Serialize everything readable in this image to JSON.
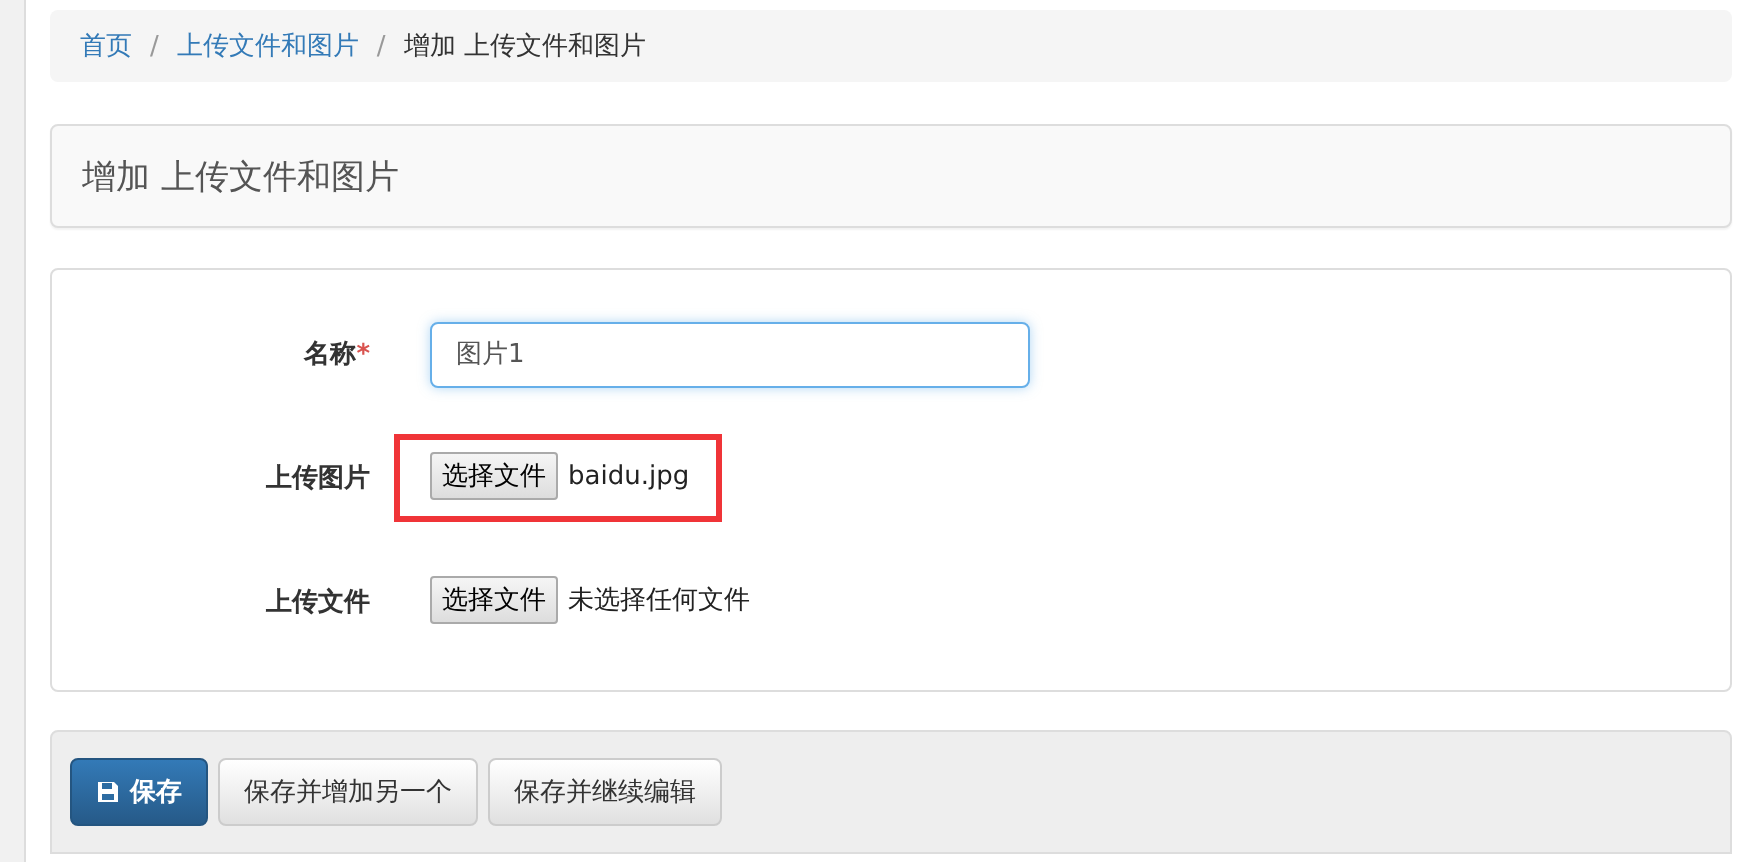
{
  "breadcrumb": [
    {
      "label": "首页",
      "link": true
    },
    {
      "label": "上传文件和图片",
      "link": true
    },
    {
      "label": "增加 上传文件和图片",
      "link": false
    }
  ],
  "separator": "/",
  "panel_title": "增加 上传文件和图片",
  "fields": [
    {
      "kind": "text",
      "label": "名称",
      "required": true,
      "value": "图片1",
      "focused": true,
      "highlighted": false
    },
    {
      "kind": "file",
      "label": "上传图片",
      "required": false,
      "button": "选择文件",
      "file_name": "baidu.jpg",
      "highlighted": true
    },
    {
      "kind": "file",
      "label": "上传文件",
      "required": false,
      "button": "选择文件",
      "file_name": "未选择任何文件",
      "highlighted": false
    }
  ],
  "required_mark": "*",
  "actions": [
    {
      "label": "保存",
      "primary": true
    },
    {
      "label": "保存并增加另一个",
      "primary": false
    },
    {
      "label": "保存并继续编辑",
      "primary": false
    }
  ]
}
